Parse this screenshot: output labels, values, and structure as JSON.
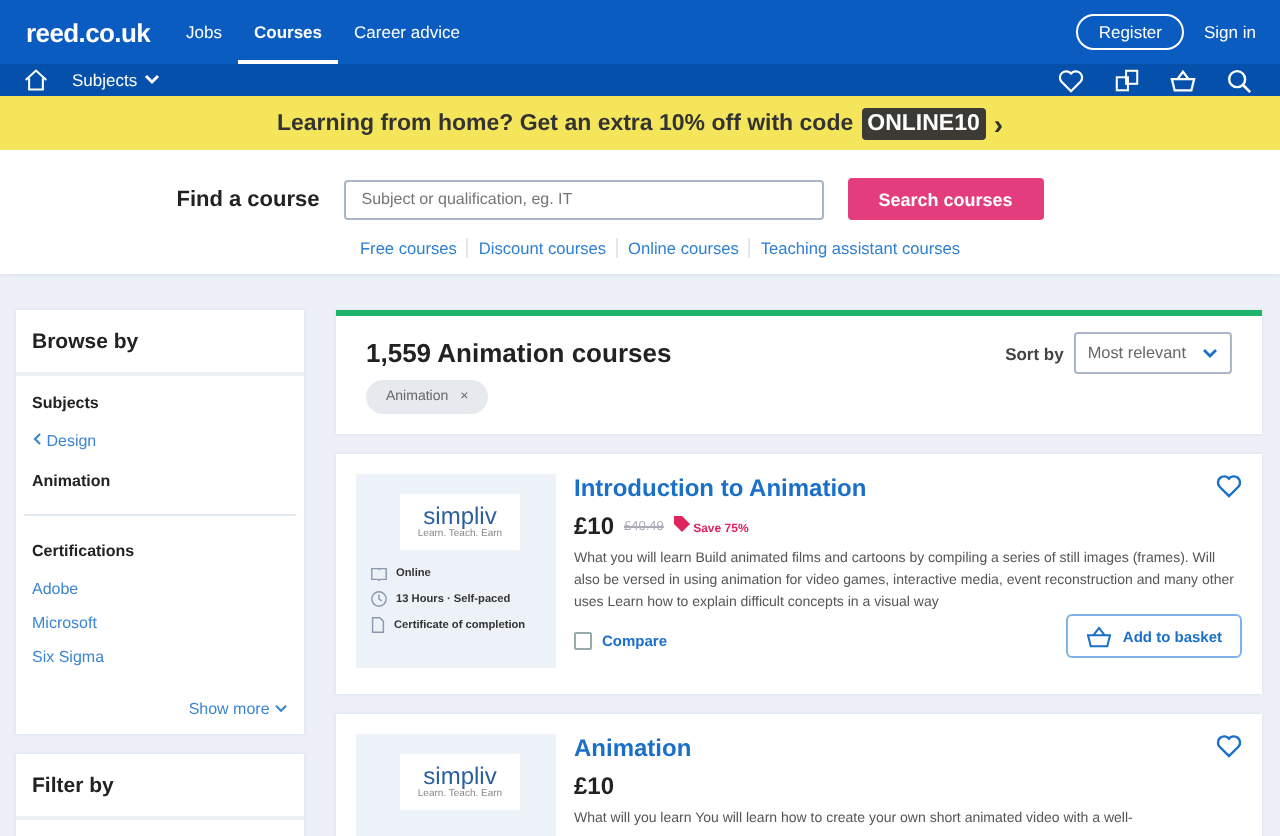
{
  "header": {
    "logo": "reed.co.uk",
    "nav": [
      {
        "label": "Jobs",
        "selected": false
      },
      {
        "label": "Courses",
        "selected": true
      },
      {
        "label": "Career advice",
        "selected": false
      }
    ],
    "register": "Register",
    "sign_in": "Sign in"
  },
  "subnav": {
    "subjects": "Subjects"
  },
  "banner": {
    "text": "Learning from home? Get an extra 10% off with code",
    "code": "ONLINE10",
    "arrow": "›"
  },
  "search": {
    "label": "Find a course",
    "placeholder": "Subject or qualification, eg. IT",
    "button": "Search courses",
    "links": [
      "Free courses",
      "Discount courses",
      "Online courses",
      "Teaching assistant courses"
    ]
  },
  "sidebar": {
    "title": "Browse by",
    "subjects_heading": "Subjects",
    "parent": "Design",
    "current": "Animation",
    "certifications_heading": "Certifications",
    "certifications": [
      "Adobe",
      "Microsoft",
      "Six Sigma"
    ],
    "show_more": "Show more",
    "filter_title": "Filter by"
  },
  "results": {
    "title": "1,559 Animation courses",
    "filter_tag": "Animation",
    "tag_remove": "×",
    "sort_label": "Sort by",
    "sort_value": "Most relevant"
  },
  "courses": [
    {
      "provider_logo": "simpliv",
      "provider_tagline": "Learn. Teach. Earn",
      "meta": [
        {
          "kind": "mode",
          "text": "Online"
        },
        {
          "kind": "duration",
          "text": "13 Hours · Self-paced"
        },
        {
          "kind": "certificate",
          "text": "Certificate of completion"
        }
      ],
      "title": "Introduction to Animation",
      "price": "£10",
      "old_price": "£40.49",
      "save": "Save 75%",
      "description": "What you will learn Build animated films and cartoons by compiling a series of still images (frames). Will also be versed in using animation for video games, interactive media, event reconstruction and many other uses Learn how to explain difficult concepts in a visual way",
      "compare": "Compare",
      "compare_checked": false,
      "basket": "Add to basket"
    },
    {
      "provider_logo": "simpliv",
      "provider_tagline": "Learn. Teach. Earn",
      "title": "Animation",
      "price": "£10",
      "description": "What will you learn You will learn how to create your own short animated video with a well-"
    }
  ]
}
